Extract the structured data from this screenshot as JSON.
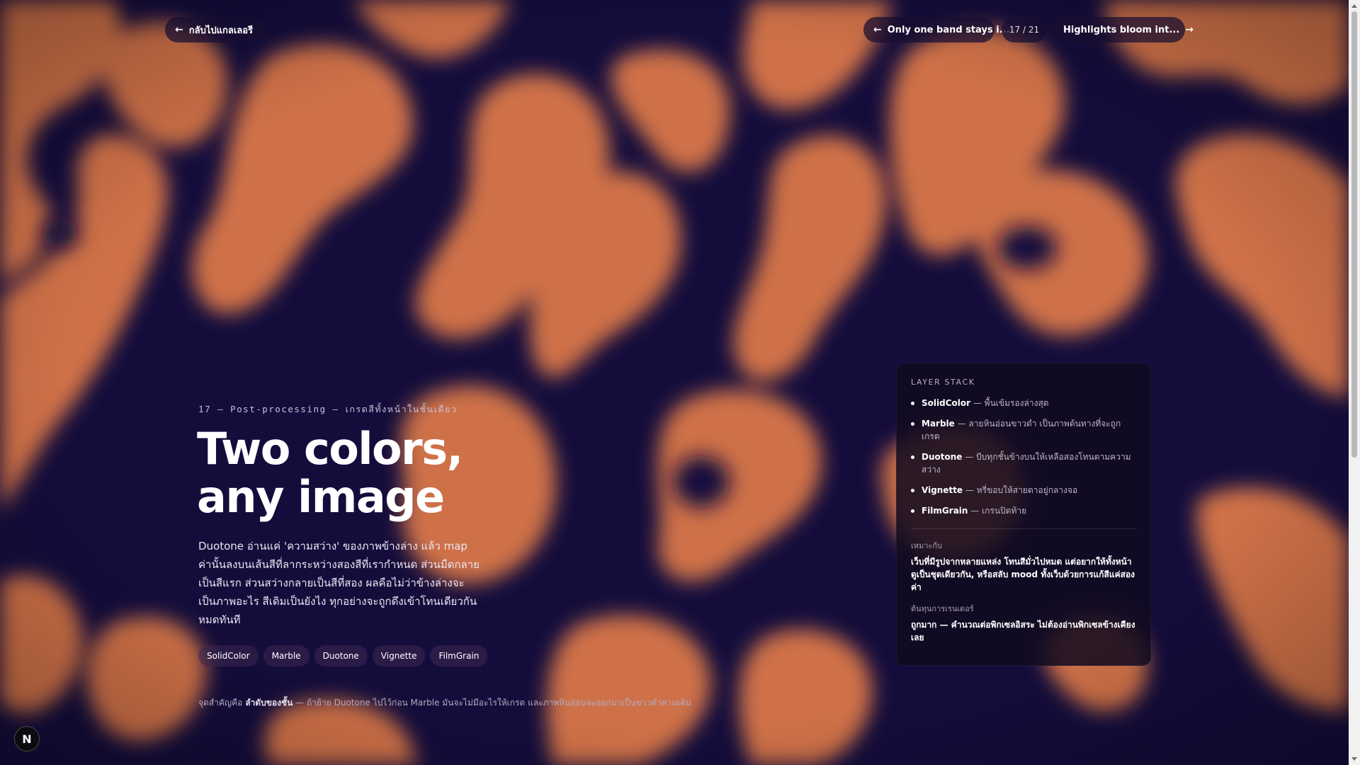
{
  "colors": {
    "background": "#120c3a",
    "blob": "#d9774a",
    "panel": "#100a20"
  },
  "topbar": {
    "back_label": "กลับไปแกลเลอรี",
    "prev_label": "Only one band stays i...",
    "counter": "17 / 21",
    "next_label": "Highlights bloom int...",
    "back_icon": "arrow-left-icon",
    "next_icon": "arrow-right-icon"
  },
  "hero": {
    "eyebrow": "17 — Post-processing — เกรดสีทั้งหน้าในชั้นเดียว",
    "title_line1": "Two colors,",
    "title_line2": "any image",
    "description": "Duotone อ่านแค่ 'ความสว่าง' ของภาพข้างล่าง แล้ว map ค่านั้นลงบนเส้นสีที่ลากระหว่างสองสีที่เรากำหนด ส่วนมืดกลายเป็นสีแรก ส่วนสว่างกลายเป็นสีที่สอง ผลคือไม่ว่าข้างล่างจะเป็นภาพอะไร สีเดิมเป็นยังไง ทุกอย่างจะถูกดึงเข้าโทนเดียวกันหมดทันที"
  },
  "tags": [
    "SolidColor",
    "Marble",
    "Duotone",
    "Vignette",
    "FilmGrain"
  ],
  "footnote": {
    "prefix": "จุดสำคัญคือ",
    "emphasis": "ลำดับของชั้น",
    "rest": "— ถ้าย้าย Duotone ไปไว้ก่อน Marble มันจะไม่มีอะไรให้เกรด และภาพหินอ่อนจะออกมาเป็นขาวดำตามเดิม"
  },
  "panel": {
    "title": "LAYER STACK",
    "layers": [
      {
        "name": "SolidColor",
        "desc": "— พื้นเข้มรองล่างสุด"
      },
      {
        "name": "Marble",
        "desc": "— ลายหินอ่อนขาวดำ เป็นภาพต้นทางที่จะถูกเกรด"
      },
      {
        "name": "Duotone",
        "desc": "— บีบทุกชั้นข้างบนให้เหลือสองโทนตามความสว่าง"
      },
      {
        "name": "Vignette",
        "desc": "— หรี่ขอบให้สายตาอยู่กลางจอ"
      },
      {
        "name": "FilmGrain",
        "desc": "— เกรนปิดท้าย"
      }
    ],
    "suited_label": "เหมาะกับ",
    "suited_text": "เว็บที่มีรูปจากหลายแหล่ง โทนสีมั่วไปหมด แต่อยากให้ทั้งหน้าดูเป็นชุดเดียวกัน, หรือสลับ mood ทั้งเว็บด้วยการแก้สีแค่สองค่า",
    "cost_label": "ต้นทุนการเรนเดอร์",
    "cost_text": "ถูกมาก — คำนวณต่อพิกเซลอิสระ ไม่ต้องอ่านพิกเซลข้างเคียงเลย"
  },
  "badge": "N"
}
